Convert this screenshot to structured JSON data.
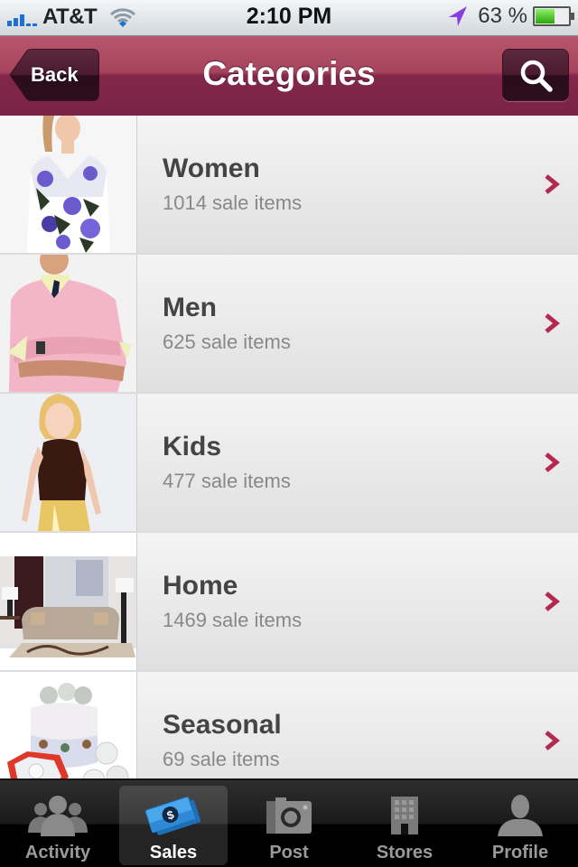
{
  "status_bar": {
    "carrier": "AT&T",
    "time": "2:10 PM",
    "battery_percent_text": "63 %",
    "battery_level": 0.63,
    "signal_bars": 3
  },
  "nav": {
    "back_label": "Back",
    "title": "Categories",
    "search_icon": "search-icon"
  },
  "categories": [
    {
      "name": "Women",
      "count_text": "1014 sale items",
      "image": "woman-floral-dress"
    },
    {
      "name": "Men",
      "count_text": "625 sale items",
      "image": "man-pink-sweater"
    },
    {
      "name": "Kids",
      "count_text": "477 sale items",
      "image": "girl-brown-top"
    },
    {
      "name": "Home",
      "count_text": "1469 sale items",
      "image": "living-room-sofa"
    },
    {
      "name": "Seasonal",
      "count_text": "69 sale items",
      "image": "holiday-ornaments"
    }
  ],
  "colors": {
    "accent": "#b5284f",
    "nav_bar": "#8a2d4e",
    "tab_active_icon": "#3aa0e8"
  },
  "tabbar": {
    "tabs": [
      {
        "label": "Activity",
        "icon": "people-icon",
        "active": false
      },
      {
        "label": "Sales",
        "icon": "money-icon",
        "active": true
      },
      {
        "label": "Post",
        "icon": "camera-icon",
        "active": false
      },
      {
        "label": "Stores",
        "icon": "building-icon",
        "active": false
      },
      {
        "label": "Profile",
        "icon": "person-icon",
        "active": false
      }
    ]
  }
}
